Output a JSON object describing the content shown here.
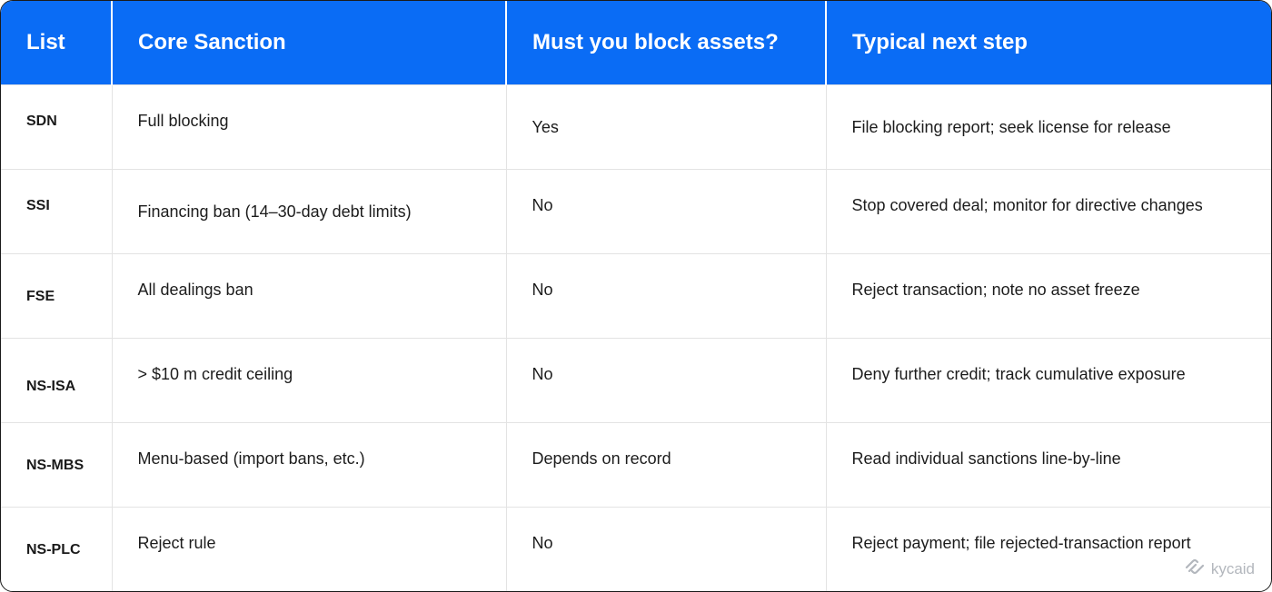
{
  "table": {
    "headers": [
      "List",
      "Core Sanction",
      "Must you block assets?",
      "Typical next step"
    ],
    "rows": [
      [
        "SDN",
        "Full blocking",
        "Yes",
        "File blocking report; seek license for release"
      ],
      [
        "SSI",
        "Financing ban (14–30-day debt limits)",
        "No",
        "Stop covered deal; monitor for directive changes"
      ],
      [
        "FSE",
        "All dealings ban",
        "No",
        "Reject transaction; note no asset freeze"
      ],
      [
        "NS-ISA",
        "> $10 m credit ceiling",
        "No",
        "Deny further credit; track cumulative exposure"
      ],
      [
        "NS-MBS",
        "Menu-based (import bans, etc.)",
        "Depends on record",
        "Read individual sanctions line-by-line"
      ],
      [
        "NS-PLC",
        "Reject rule",
        "No",
        "Reject payment; file rejected-transaction report"
      ]
    ]
  },
  "brand": {
    "name": "kycaid",
    "icon": "kycaid-logo-icon",
    "accent": "#0a6cf5"
  }
}
